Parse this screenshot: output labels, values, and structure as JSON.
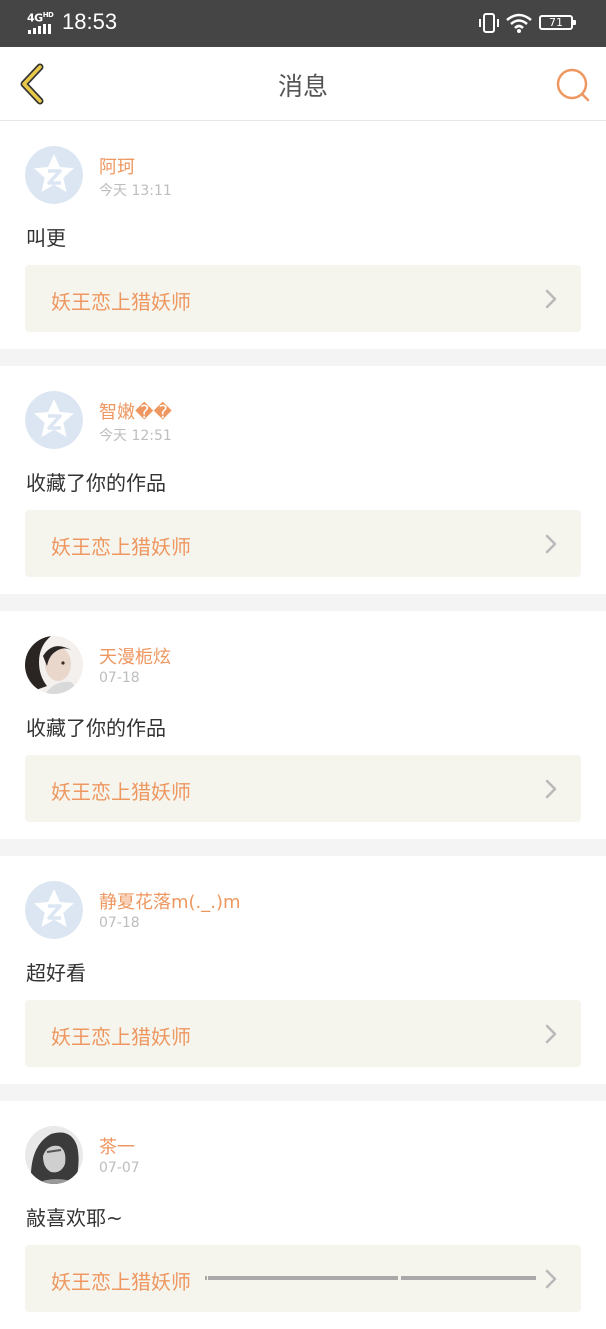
{
  "status_bar": {
    "network": "4G",
    "network_sup": "HD",
    "time": "18:53",
    "battery": "71"
  },
  "navbar": {
    "title": "消息",
    "back_icon": "chevron-left-icon",
    "search_icon": "search-icon"
  },
  "colors": {
    "accent": "#ee9760",
    "back_icon": "#e8c94a",
    "status_bar": "#454545",
    "work_bg": "#f5f5ee"
  },
  "messages": [
    {
      "name": "阿珂",
      "time": "今天 13:11",
      "text": "叫更",
      "work": "妖王恋上猎妖师",
      "avatar": "default-qq-avatar"
    },
    {
      "name": "智嫩��",
      "time": "今天 12:51",
      "text": "收藏了你的作品",
      "work": "妖王恋上猎妖师",
      "avatar": "default-qq-avatar"
    },
    {
      "name": "天漫栀炫",
      "time": "07-18",
      "text": "收藏了你的作品",
      "work": "妖王恋上猎妖师",
      "avatar": "photo-avatar-portrait"
    },
    {
      "name": "静夏花落m(._.)m",
      "time": "07-18",
      "text": "超好看",
      "work": "妖王恋上猎妖师",
      "avatar": "default-qq-avatar"
    },
    {
      "name": "茶一",
      "time": "07-07",
      "text": "敲喜欢耶~",
      "work": "妖王恋上猎妖师",
      "avatar": "photo-avatar-sketch"
    }
  ]
}
